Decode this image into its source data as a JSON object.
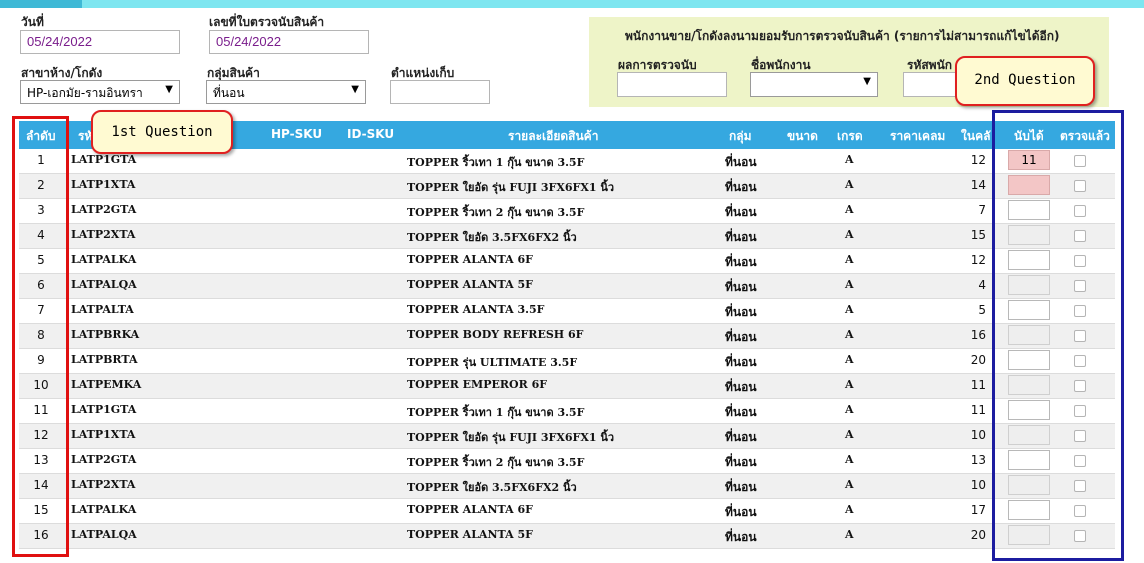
{
  "form": {
    "date_label": "วันที่",
    "date_value": "05/24/2022",
    "doc_no_label": "เลขที่ใบตรวจนับสินค้า",
    "doc_no_value": "05/24/2022",
    "branch_label": "สาขาห้าง/โกดัง",
    "branch_value": "HP-เอกมัย-รามอินทรา",
    "group_label": "กลุ่มสินค้า",
    "group_value": "ที่นอน",
    "location_label": "ตำแหน่งเก็บ",
    "location_value": ""
  },
  "panel": {
    "title": "พนักงานขาย/โกดังลงนามยอมรับการตรวจนับสินค้า (รายการไม่สามารถแก้ไขได้อีก)",
    "result_label": "ผลการตรวจนับ",
    "employee_name_label": "ชื่อพนักงาน",
    "employee_code_label": "รหัสพนัก"
  },
  "table": {
    "headers": {
      "no": "ลำดับ",
      "code": "รหั",
      "hp_sku": "HP-SKU",
      "id_sku": "ID-SKU",
      "desc": "รายละเอียดสินค้า",
      "group": "กลุ่ม",
      "size": "ขนาด",
      "grade": "เกรด",
      "price": "ราคาเคลม",
      "stock": "ในคลั",
      "counted": "นับได้",
      "checked": "ตรวจแล้ว"
    },
    "rows": [
      {
        "no": "1",
        "code": "LATP1GTA",
        "desc": "TOPPER ริ้วเทา 1 กุ๊น ขนาด 3.5F",
        "group": "ที่นอน",
        "grade": "A",
        "stock": "12",
        "counted": "11"
      },
      {
        "no": "2",
        "code": "LATP1XTA",
        "desc": "TOPPER ใยอัด รุ่น FUJI 3FX6FX1 นิ้ว",
        "group": "ที่นอน",
        "grade": "A",
        "stock": "14",
        "counted": ""
      },
      {
        "no": "3",
        "code": "LATP2GTA",
        "desc": "TOPPER ริ้วเทา 2 กุ๊น ขนาด 3.5F",
        "group": "ที่นอน",
        "grade": "A",
        "stock": "7",
        "counted": ""
      },
      {
        "no": "4",
        "code": "LATP2XTA",
        "desc": "TOPPER ใยอัด 3.5FX6FX2 นิ้ว",
        "group": "ที่นอน",
        "grade": "A",
        "stock": "15",
        "counted": ""
      },
      {
        "no": "5",
        "code": "LATPALKA",
        "desc": "TOPPER ALANTA 6F",
        "group": "ที่นอน",
        "grade": "A",
        "stock": "12",
        "counted": ""
      },
      {
        "no": "6",
        "code": "LATPALQA",
        "desc": "TOPPER ALANTA 5F",
        "group": "ที่นอน",
        "grade": "A",
        "stock": "4",
        "counted": ""
      },
      {
        "no": "7",
        "code": "LATPALTA",
        "desc": "TOPPER ALANTA 3.5F",
        "group": "ที่นอน",
        "grade": "A",
        "stock": "5",
        "counted": ""
      },
      {
        "no": "8",
        "code": "LATPBRKA",
        "desc": "TOPPER BODY REFRESH  6F",
        "group": "ที่นอน",
        "grade": "A",
        "stock": "16",
        "counted": ""
      },
      {
        "no": "9",
        "code": "LATPBRTA",
        "desc": "TOPPER รุ่น ULTIMATE 3.5F",
        "group": "ที่นอน",
        "grade": "A",
        "stock": "20",
        "counted": ""
      },
      {
        "no": "10",
        "code": "LATPEMKA",
        "desc": "TOPPER EMPEROR 6F",
        "group": "ที่นอน",
        "grade": "A",
        "stock": "11",
        "counted": ""
      },
      {
        "no": "11",
        "code": "LATP1GTA",
        "desc": "TOPPER ริ้วเทา 1 กุ๊น ขนาด 3.5F",
        "group": "ที่นอน",
        "grade": "A",
        "stock": "11",
        "counted": ""
      },
      {
        "no": "12",
        "code": "LATP1XTA",
        "desc": "TOPPER ใยอัด รุ่น FUJI 3FX6FX1 นิ้ว",
        "group": "ที่นอน",
        "grade": "A",
        "stock": "10",
        "counted": ""
      },
      {
        "no": "13",
        "code": "LATP2GTA",
        "desc": "TOPPER ริ้วเทา 2 กุ๊น ขนาด 3.5F",
        "group": "ที่นอน",
        "grade": "A",
        "stock": "13",
        "counted": ""
      },
      {
        "no": "14",
        "code": "LATP2XTA",
        "desc": "TOPPER ใยอัด 3.5FX6FX2 นิ้ว",
        "group": "ที่นอน",
        "grade": "A",
        "stock": "10",
        "counted": ""
      },
      {
        "no": "15",
        "code": "LATPALKA",
        "desc": "TOPPER ALANTA 6F",
        "group": "ที่นอน",
        "grade": "A",
        "stock": "17",
        "counted": ""
      },
      {
        "no": "16",
        "code": "LATPALQA",
        "desc": "TOPPER ALANTA 5F",
        "group": "ที่นอน",
        "grade": "A",
        "stock": "20",
        "counted": ""
      }
    ]
  },
  "annotations": {
    "first": "1st Question",
    "second": "2nd Question"
  },
  "colors": {
    "header_bg": "#35a8e0",
    "panel_bg": "#eef4c8",
    "top_bar": "#7ee6f0",
    "red_frame": "#e01010",
    "blue_frame": "#1c1ca0"
  }
}
